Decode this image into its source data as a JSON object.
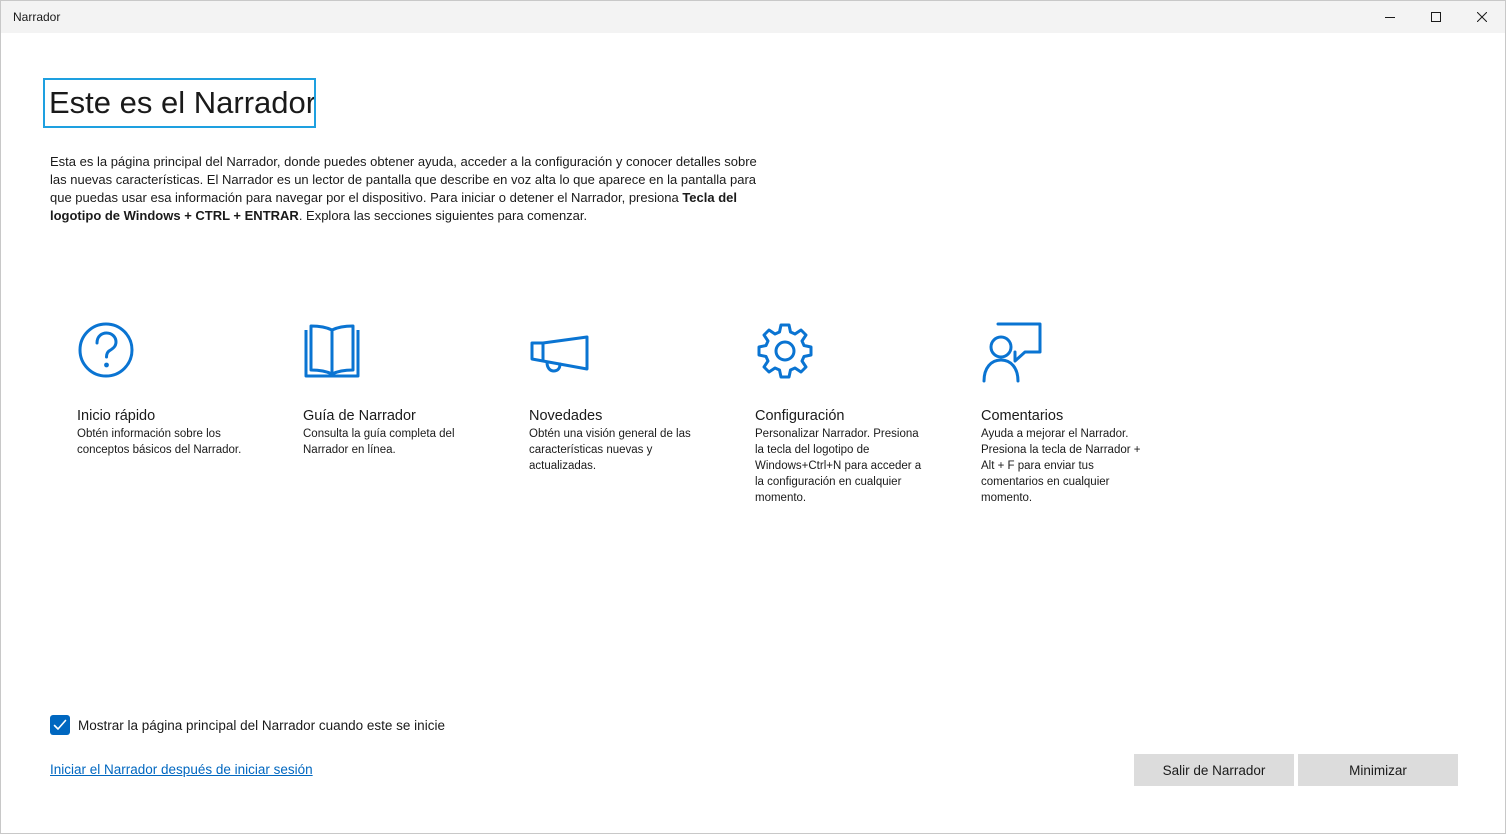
{
  "window": {
    "title": "Narrador"
  },
  "main": {
    "heading": "Este es el Narrador",
    "intro_text_1": "Esta es la página principal del Narrador, donde puedes obtener ayuda, acceder a la configuración y conocer detalles sobre las nuevas características. El Narrador es un lector de pantalla que describe en voz alta lo que aparece en la pantalla para que puedas usar esa información para navegar por el dispositivo. Para iniciar o detener el Narrador, presiona ",
    "intro_shortcut": "Tecla del logotipo de Windows + CTRL + ENTRAR",
    "intro_text_2": ". Explora las secciones siguientes para comenzar."
  },
  "cards": [
    {
      "icon": "question-circle-icon",
      "title": "Inicio rápido",
      "description": "Obtén información sobre los conceptos básicos del Narrador."
    },
    {
      "icon": "book-icon",
      "title": "Guía de Narrador",
      "description": "Consulta la guía completa del Narrador en línea."
    },
    {
      "icon": "megaphone-icon",
      "title": "Novedades",
      "description": "Obtén una visión general de las características nuevas y actualizadas."
    },
    {
      "icon": "gear-icon",
      "title": "Configuración",
      "description": "Personalizar Narrador. Presiona la tecla del logotipo de Windows+Ctrl+N para acceder a la configuración en cualquier momento."
    },
    {
      "icon": "feedback-person-icon",
      "title": "Comentarios",
      "description": "Ayuda a mejorar el Narrador. Presiona la tecla de Narrador + Alt + F para enviar tus comentarios en cualquier momento."
    }
  ],
  "footer": {
    "checkbox_label": "Mostrar la página principal del Narrador cuando este se inicie",
    "checkbox_checked": true,
    "link_text": "Iniciar el Narrador después de iniciar sesión",
    "exit_button": "Salir de Narrador",
    "minimize_button": "Minimizar"
  },
  "colors": {
    "accent": "#0067c0",
    "icon_blue": "#0a74d2",
    "focus_border": "#1ea0e0",
    "button_bg": "#dcdcdc"
  }
}
